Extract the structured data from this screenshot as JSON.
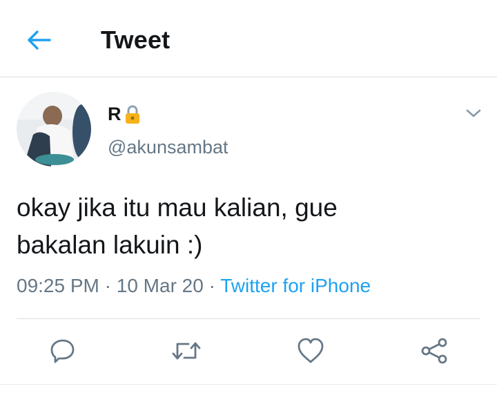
{
  "header": {
    "title": "Tweet",
    "back_icon": "arrow-left-icon"
  },
  "tweet": {
    "author": {
      "display_name": "R",
      "handle": "@akunsambat",
      "badge_icon": "lock-icon"
    },
    "text_line1": "okay jika itu mau kalian, gue",
    "text_line2": "bakalan lakuin :)",
    "time": "09:25 PM",
    "separator": " · ",
    "date": "10 Mar 20",
    "source": "Twitter for iPhone"
  },
  "actions": [
    {
      "icon": "reply-icon"
    },
    {
      "icon": "retweet-icon"
    },
    {
      "icon": "like-icon"
    },
    {
      "icon": "share-icon"
    }
  ],
  "colors": {
    "accent": "#1da1f2",
    "secondary_text": "#657786",
    "primary_text": "#14171a"
  }
}
